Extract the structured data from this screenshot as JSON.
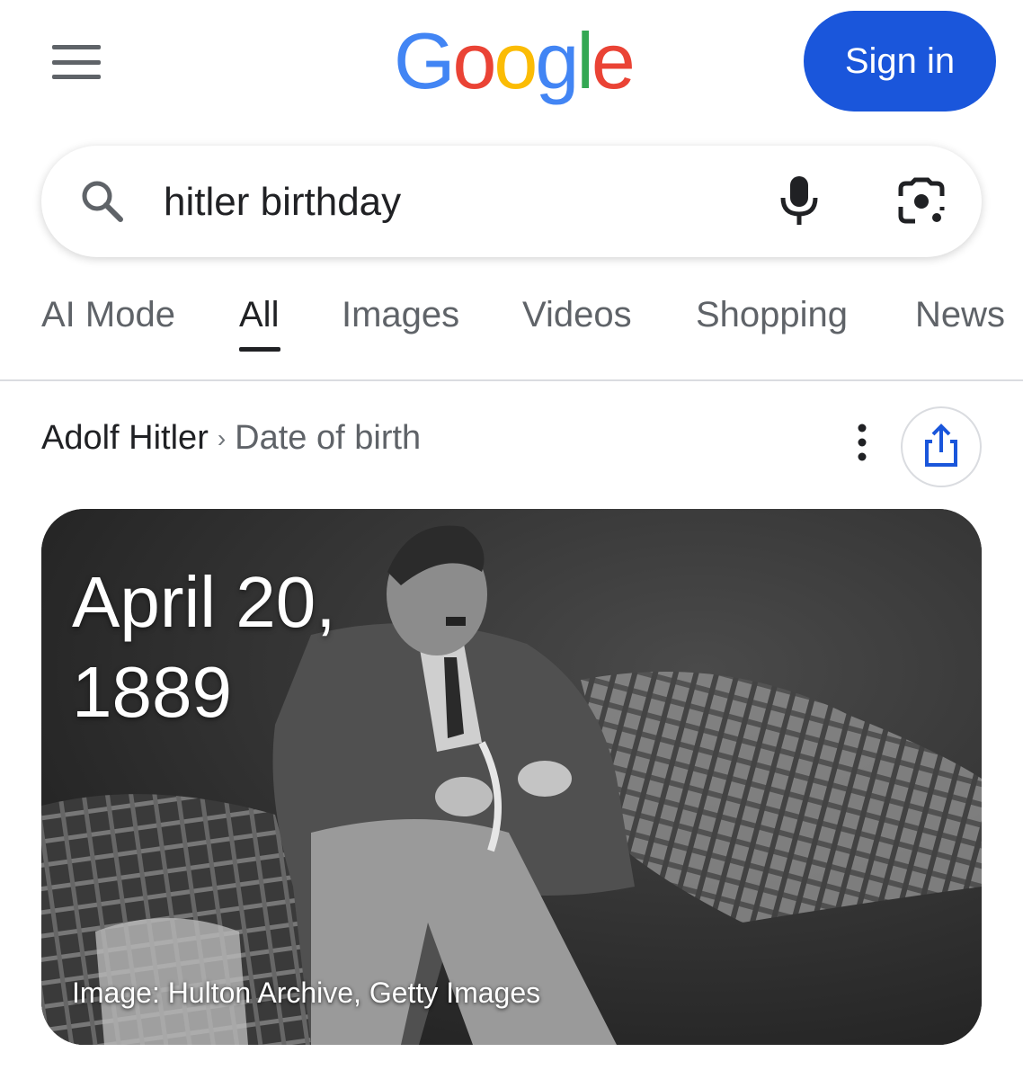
{
  "header": {
    "logo_letters": [
      "G",
      "o",
      "o",
      "g",
      "l",
      "e"
    ],
    "logo_colors": [
      "#4285F4",
      "#EA4335",
      "#FBBC05",
      "#4285F4",
      "#34A853",
      "#EA4335"
    ],
    "signin_label": "Sign in",
    "accent": "#1a56db"
  },
  "search": {
    "query": "hitler birthday"
  },
  "tabs": [
    {
      "label": "AI Mode"
    },
    {
      "label": "All",
      "active": true
    },
    {
      "label": "Images"
    },
    {
      "label": "Videos"
    },
    {
      "label": "Shopping"
    },
    {
      "label": "News"
    }
  ],
  "result": {
    "entity": "Adolf Hitler",
    "separator": "›",
    "attribute": "Date of birth",
    "answer_line1": "April 20,",
    "answer_line2": "1889",
    "image_credit": "Image: Hulton Archive, Getty Images"
  },
  "icons": {
    "menu": "hamburger-menu-icon",
    "search": "search-icon",
    "mic": "microphone-icon",
    "lens": "google-lens-camera-icon",
    "more": "more-vertical-icon",
    "share": "share-icon"
  }
}
